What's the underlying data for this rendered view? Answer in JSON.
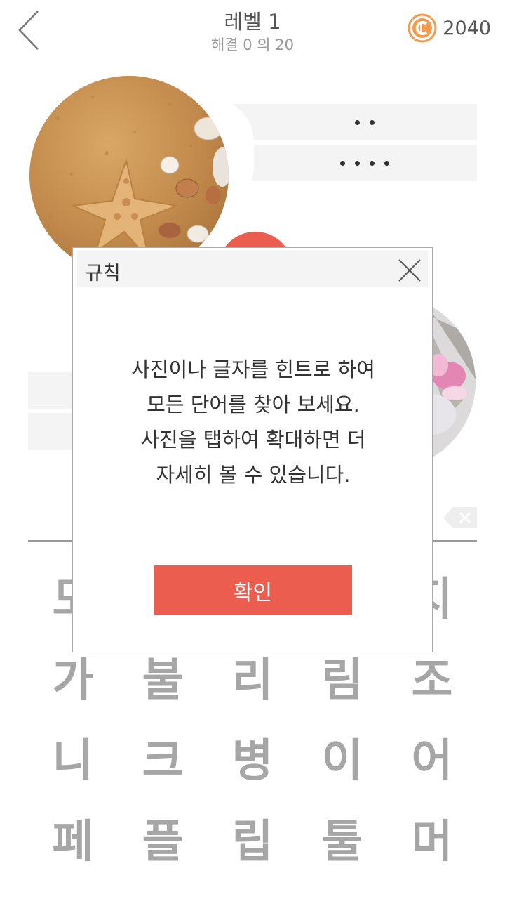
{
  "header": {
    "title": "레벨 1",
    "subtitle": "해결 0 의 20",
    "coins": "2040"
  },
  "colors": {
    "accent": "#ea5d4f",
    "coin": "#f39a4f",
    "letter": "#a6a6a6"
  },
  "grid": {
    "rows": [
      [
        "도",
        "",
        "",
        "",
        "지"
      ],
      [
        "가",
        "불",
        "리",
        "림",
        "조"
      ],
      [
        "니",
        "크",
        "병",
        "이",
        "어"
      ],
      [
        "페",
        "플",
        "립",
        "툴",
        "머"
      ]
    ]
  },
  "modal": {
    "title": "규칙",
    "lines": [
      "사진이나 글자를 힌트로 하여",
      "모든 단어를 찾아 보세요.",
      "사진을 탭하여 확대하면 더",
      "자세히 볼 수 있습니다."
    ],
    "confirm_label": "확인"
  }
}
